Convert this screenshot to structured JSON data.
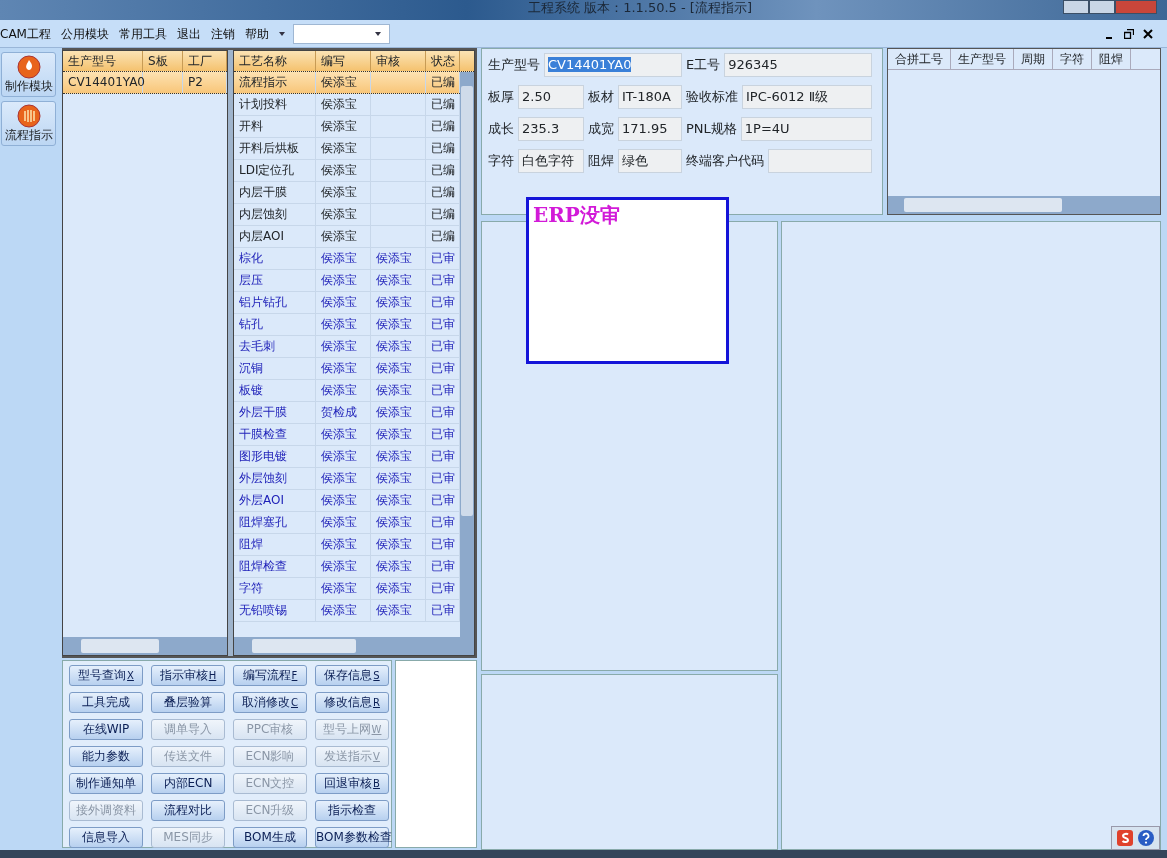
{
  "window": {
    "title": "工程系统   版本：1.1.50.5 - [流程指示]"
  },
  "menu": [
    {
      "label": "CAM工程"
    },
    {
      "label": "公用模块"
    },
    {
      "label": "常用工具"
    },
    {
      "label": "退出"
    },
    {
      "label": "注销"
    },
    {
      "label": "帮助"
    }
  ],
  "nav": [
    {
      "label": "制作模块",
      "kind": "flame"
    },
    {
      "label": "流程指示",
      "kind": "bars"
    }
  ],
  "model_grid": {
    "columns": [
      "生产型号",
      "S板",
      "工厂"
    ],
    "rows": [
      {
        "cells": [
          "CV14401YA0",
          "",
          "P2"
        ],
        "selected": true
      }
    ]
  },
  "process_grid": {
    "columns": [
      "工艺名称",
      "编写",
      "审核",
      "状态"
    ],
    "rows": [
      {
        "cells": [
          "流程指示",
          "侯添宝",
          "",
          "已编"
        ],
        "kind": "edited",
        "selected": true
      },
      {
        "cells": [
          "计划投料",
          "侯添宝",
          "",
          "已编"
        ],
        "kind": "edited",
        "selected": false
      },
      {
        "cells": [
          "开料",
          "侯添宝",
          "",
          "已编"
        ],
        "kind": "edited",
        "selected": false
      },
      {
        "cells": [
          "开料后烘板",
          "侯添宝",
          "",
          "已编"
        ],
        "kind": "edited",
        "selected": false
      },
      {
        "cells": [
          "LDI定位孔",
          "侯添宝",
          "",
          "已编"
        ],
        "kind": "edited",
        "selected": false
      },
      {
        "cells": [
          "内层干膜",
          "侯添宝",
          "",
          "已编"
        ],
        "kind": "edited",
        "selected": false
      },
      {
        "cells": [
          "内层蚀刻",
          "侯添宝",
          "",
          "已编"
        ],
        "kind": "edited",
        "selected": false
      },
      {
        "cells": [
          "内层AOI",
          "侯添宝",
          "",
          "已编"
        ],
        "kind": "edited",
        "selected": false
      },
      {
        "cells": [
          "棕化",
          "侯添宝",
          "侯添宝",
          "已审"
        ],
        "kind": "reviewed",
        "selected": false
      },
      {
        "cells": [
          "层压",
          "侯添宝",
          "侯添宝",
          "已审"
        ],
        "kind": "reviewed",
        "selected": false
      },
      {
        "cells": [
          "铝片钻孔",
          "侯添宝",
          "侯添宝",
          "已审"
        ],
        "kind": "reviewed",
        "selected": false
      },
      {
        "cells": [
          "钻孔",
          "侯添宝",
          "侯添宝",
          "已审"
        ],
        "kind": "reviewed",
        "selected": false
      },
      {
        "cells": [
          "去毛刺",
          "侯添宝",
          "侯添宝",
          "已审"
        ],
        "kind": "reviewed",
        "selected": false
      },
      {
        "cells": [
          "沉铜",
          "侯添宝",
          "侯添宝",
          "已审"
        ],
        "kind": "reviewed",
        "selected": false
      },
      {
        "cells": [
          "板镀",
          "侯添宝",
          "侯添宝",
          "已审"
        ],
        "kind": "reviewed",
        "selected": false
      },
      {
        "cells": [
          "外层干膜",
          "贺检成",
          "侯添宝",
          "已审"
        ],
        "kind": "reviewed",
        "selected": false
      },
      {
        "cells": [
          "干膜检查",
          "侯添宝",
          "侯添宝",
          "已审"
        ],
        "kind": "reviewed",
        "selected": false
      },
      {
        "cells": [
          "图形电镀",
          "侯添宝",
          "侯添宝",
          "已审"
        ],
        "kind": "reviewed",
        "selected": false
      },
      {
        "cells": [
          "外层蚀刻",
          "侯添宝",
          "侯添宝",
          "已审"
        ],
        "kind": "reviewed",
        "selected": false
      },
      {
        "cells": [
          "外层AOI",
          "侯添宝",
          "侯添宝",
          "已审"
        ],
        "kind": "reviewed",
        "selected": false
      },
      {
        "cells": [
          "阻焊塞孔",
          "侯添宝",
          "侯添宝",
          "已审"
        ],
        "kind": "reviewed",
        "selected": false
      },
      {
        "cells": [
          "阻焊",
          "侯添宝",
          "侯添宝",
          "已审"
        ],
        "kind": "reviewed",
        "selected": false
      },
      {
        "cells": [
          "阻焊检查",
          "侯添宝",
          "侯添宝",
          "已审"
        ],
        "kind": "reviewed",
        "selected": false
      },
      {
        "cells": [
          "字符",
          "侯添宝",
          "侯添宝",
          "已审"
        ],
        "kind": "reviewed",
        "selected": false
      },
      {
        "cells": [
          "无铅喷锡",
          "侯添宝",
          "侯添宝",
          "已审"
        ],
        "kind": "reviewed",
        "selected": false
      }
    ]
  },
  "buttons": [
    {
      "label": "型号查询",
      "hotkey": "X",
      "disabled": false
    },
    {
      "label": "指示审核",
      "hotkey": "H",
      "disabled": false
    },
    {
      "label": "编写流程",
      "hotkey": "F",
      "disabled": false
    },
    {
      "label": "保存信息",
      "hotkey": "S",
      "disabled": false
    },
    {
      "label": "工具完成",
      "disabled": false
    },
    {
      "label": "叠层验算",
      "disabled": false
    },
    {
      "label": "取消修改",
      "hotkey": "C",
      "disabled": false
    },
    {
      "label": "修改信息",
      "hotkey": "R",
      "disabled": false
    },
    {
      "label": "在线WIP",
      "disabled": false
    },
    {
      "label": "调单导入",
      "disabled": true
    },
    {
      "label": "PPC审核",
      "disabled": true
    },
    {
      "label": "型号上网",
      "hotkey": "W",
      "disabled": true
    },
    {
      "label": "能力参数",
      "disabled": false
    },
    {
      "label": "传送文件",
      "disabled": true
    },
    {
      "label": "ECN影响",
      "disabled": true
    },
    {
      "label": "发送指示",
      "hotkey": "V",
      "disabled": true
    },
    {
      "label": "制作通知单",
      "disabled": false
    },
    {
      "label": "内部ECN",
      "disabled": false
    },
    {
      "label": "ECN文控",
      "disabled": true
    },
    {
      "label": "回退审核",
      "hotkey": "B",
      "disabled": false
    },
    {
      "label": "接外调资料",
      "disabled": true
    },
    {
      "label": "流程对比",
      "disabled": false
    },
    {
      "label": "ECN升级",
      "disabled": true
    },
    {
      "label": "指示检查",
      "disabled": false
    },
    {
      "label": "信息导入",
      "disabled": false
    },
    {
      "label": "MES同步",
      "disabled": true
    },
    {
      "label": "BOM生成",
      "disabled": false
    },
    {
      "label": "BOM参数检查",
      "disabled": false
    }
  ],
  "info_form": {
    "fields": [
      {
        "label": "生产型号",
        "value": "CV14401YA0",
        "highlighted": true
      },
      {
        "label": "E工号",
        "value": "926345",
        "highlighted": false
      },
      {
        "label": "板厚",
        "value": "2.50",
        "highlighted": false
      },
      {
        "label": "板材",
        "value": "IT-180A",
        "highlighted": false
      },
      {
        "label": "验收标准",
        "value": "IPC-6012 Ⅱ级",
        "highlighted": false
      },
      {
        "label": "成长",
        "value": "235.3",
        "highlighted": false
      },
      {
        "label": "成宽",
        "value": "171.95",
        "highlighted": false
      },
      {
        "label": "PNL规格",
        "value": "1P=4U",
        "highlighted": false
      },
      {
        "label": "字符",
        "value": "白色字符",
        "highlighted": false
      },
      {
        "label": "阻焊",
        "value": "绿色",
        "highlighted": false
      },
      {
        "label": "终端客户代码"
      }
    ]
  },
  "merge_grid": {
    "columns": [
      "合拼工号",
      "生产型号",
      "周期",
      "字符",
      "阻焊"
    ]
  },
  "erp_notice": {
    "text": "ERP没审"
  }
}
